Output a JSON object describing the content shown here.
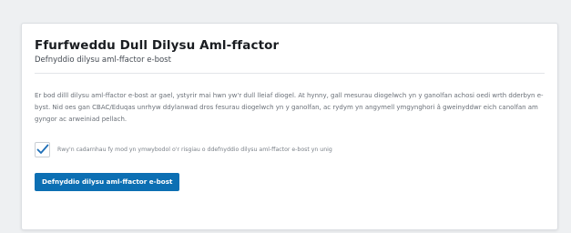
{
  "mfa_form": {
    "title": "Ffurfweddu Dull Dilysu Aml-ffactor",
    "subtitle": "Defnyddio dilysu aml-ffactor e-bost",
    "description": "Er bod dilll dilysu aml-ffactor e-bost ar gael, ystyrir mai hwn yw'r dull lleiaf diogel. At hynny, gall mesurau diogelwch yn y ganolfan achosi oedi wrth dderbyn e-byst. Nid oes gan CBAC/Eduqas unrhyw ddylanwad dros fesurau diogelwch yn y ganolfan, ac rydym yn angymell ymgynghori â gweinyddwr eich canolfan am gyngor ac arweiniad pellach.",
    "consent": {
      "checked": true,
      "label": "Rwy'n cadarnhau fy mod yn ymwybodol o'r risgiau o ddefnyddio dilysu aml-ffactor e-bost yn unig"
    },
    "submit_label": "Defnyddio dilysu aml-ffactor e-bost"
  },
  "colors": {
    "accent": "#0c6fb3",
    "check": "#1e6fb8"
  },
  "icons": {
    "consent_check": "checkmark-icon"
  }
}
